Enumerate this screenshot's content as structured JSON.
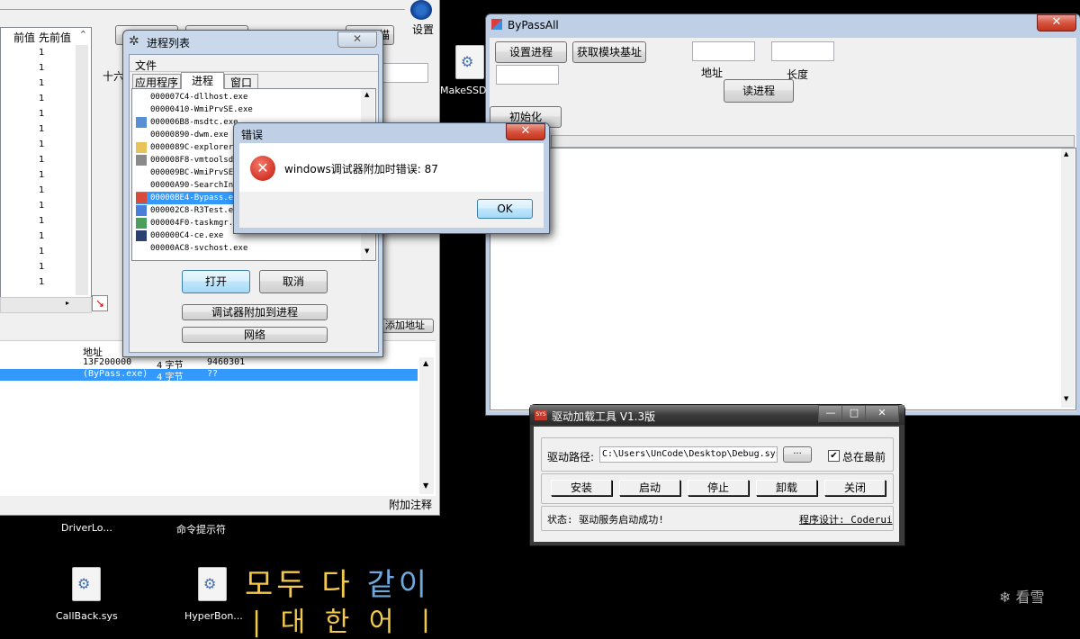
{
  "colors": {
    "desktop": "#000000",
    "selection": "#3399ff",
    "korean": "#f2c94c",
    "korean_blue": "#6fa8dc"
  },
  "ce_main": {
    "col_prev_value": "前值",
    "col_first_value": "先前值",
    "list_values": [
      "1",
      "1",
      "1",
      "1",
      "1",
      "1",
      "1",
      "1",
      "1",
      "1",
      "1",
      "1",
      "1",
      "1",
      "1",
      "1"
    ],
    "settings_label": "设置",
    "hex_label": "十六",
    "scan_label": "描",
    "add_address_button": "添加地址",
    "address_header": "地址",
    "rows": [
      {
        "address": "13F200000",
        "type": "4 字节",
        "value": "9460301"
      },
      {
        "address": "(ByPass.exe)",
        "type": "4 字节",
        "value": "??"
      }
    ],
    "attach_comment_button": "附加注释"
  },
  "process_list": {
    "title": "进程列表",
    "menu_file": "文件",
    "tabs": [
      "应用程序",
      "进程",
      "窗口"
    ],
    "processes": [
      "000007C4-dllhost.exe",
      "00000410-WmiPrvSE.exe",
      "000006B8-msdtc.exe",
      "00000890-dwm.exe",
      "0000089C-explorer",
      "000008F8-vmtoolsd",
      "000009BC-WmiPrvSE",
      "00000A90-SearchIn",
      "00000BE4-Bypass.exe",
      "000002C8-R3Test.exe",
      "000004F0-taskmgr.",
      "000000C4-ce.exe",
      "00000AC8-svchost.exe"
    ],
    "selected_index": 8,
    "open_button": "打开",
    "cancel_button": "取消",
    "attach_debugger_button": "调试器附加到进程",
    "network_button": "网络"
  },
  "error_dialog": {
    "title": "错误",
    "message": "windows调试器附加时错误: 87",
    "ok_button": "OK"
  },
  "bypassall": {
    "title": "ByPassAll",
    "set_process_button": "设置进程",
    "get_module_base_button": "获取模块基址",
    "address_label": "地址",
    "length_label": "长度",
    "read_process_button": "读进程",
    "init_button": "初始化"
  },
  "driver_tool": {
    "title": "驱动加载工具 V1.3版",
    "icon_text": "SYS",
    "path_label": "驱动路径:",
    "path_value": "C:\\Users\\UnCode\\Desktop\\Debug.sys",
    "browse_button": "···",
    "topmost_label": "总在最前",
    "topmost_checked": true,
    "install_button": "安装",
    "start_button": "启动",
    "stop_button": "停止",
    "unload_button": "卸载",
    "close_button": "关闭",
    "status_text": "状态: 驱动服务启动成功!",
    "designer_text": "程序设计: Coderui"
  },
  "desktop": {
    "makessd_label": "MakeSSD",
    "driverlo_label": "DriverLo...",
    "cmd_label": "命令提示符",
    "callback_label": "CallBack.sys",
    "hyperbon_label": "HyperBon...",
    "korean_line1_a": "모두 다",
    "korean_line1_b": "같이",
    "korean_line2": "| 대 한 어 ㅣ",
    "watermark": "看雪"
  }
}
